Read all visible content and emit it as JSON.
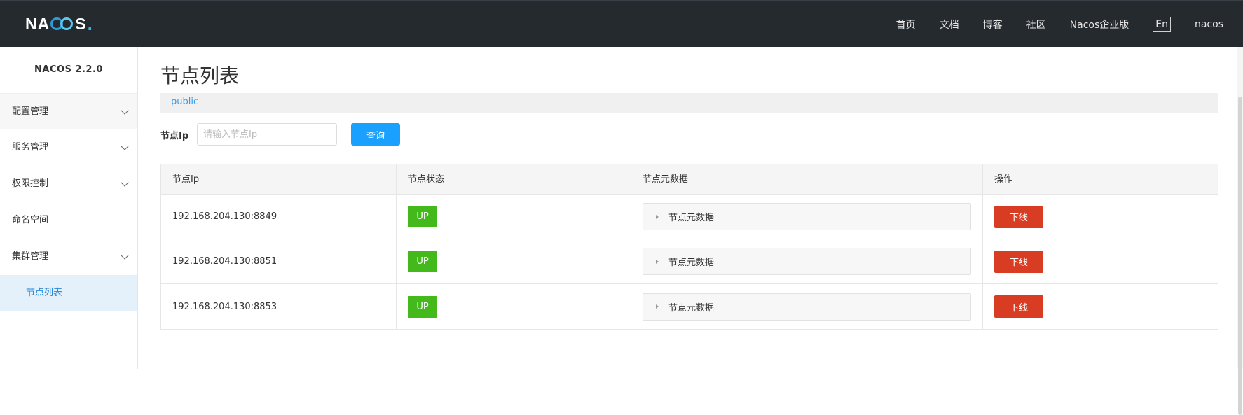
{
  "header": {
    "logo_text_left": "NA",
    "logo_text_right": "S",
    "logo_dot": ".",
    "nav": [
      "首页",
      "文档",
      "博客",
      "社区",
      "Nacos企业版"
    ],
    "lang_button": "En",
    "user": "nacos"
  },
  "sidebar": {
    "version": "NACOS 2.2.0",
    "items": [
      {
        "label": "配置管理"
      },
      {
        "label": "服务管理"
      },
      {
        "label": "权限控制"
      },
      {
        "label": "命名空间"
      },
      {
        "label": "集群管理"
      }
    ],
    "sub_item": "节点列表"
  },
  "main": {
    "title": "节点列表",
    "namespace": "public",
    "search": {
      "label": "节点Ip",
      "placeholder": "请输入节点Ip",
      "value": "",
      "button": "查询"
    },
    "table": {
      "headers": [
        "节点Ip",
        "节点状态",
        "节点元数据",
        "操作"
      ],
      "rows": [
        {
          "ip": "192.168.204.130:8849",
          "status": "UP",
          "metadata": "节点元数据",
          "action": "下线"
        },
        {
          "ip": "192.168.204.130:8851",
          "status": "UP",
          "metadata": "节点元数据",
          "action": "下线"
        },
        {
          "ip": "192.168.204.130:8853",
          "status": "UP",
          "metadata": "节点元数据",
          "action": "下线"
        }
      ]
    }
  },
  "colors": {
    "header_bg": "#252a2f",
    "primary": "#1aa1ff",
    "status_up": "#44b91b",
    "danger": "#d83c23",
    "active_menu_bg": "#e4f1fb"
  }
}
